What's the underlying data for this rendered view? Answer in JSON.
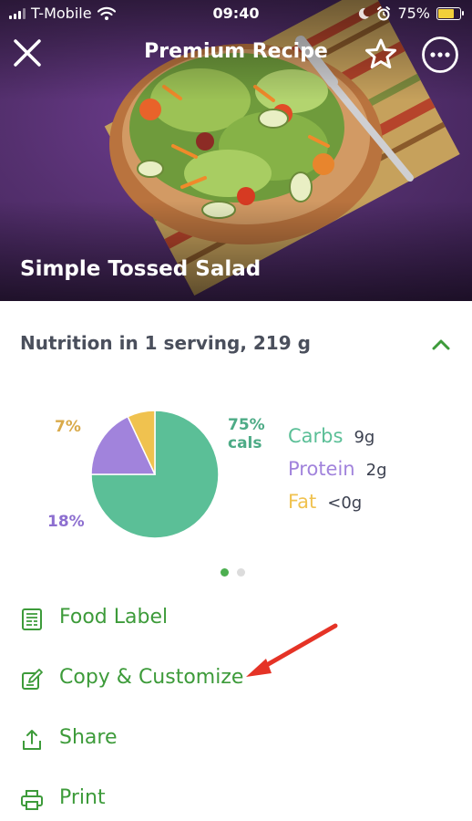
{
  "status_bar": {
    "carrier": "T-Mobile",
    "time": "09:40",
    "battery_percent": "75%",
    "battery_level": 0.75
  },
  "nav": {
    "title": "Premium Recipe",
    "close_icon": "close-icon",
    "favorite_icon": "star-outline-icon",
    "more_icon": "more-horizontal-icon"
  },
  "recipe": {
    "title": "Simple Tossed Salad"
  },
  "nutrition": {
    "header": "Nutrition in 1 serving, 219 g",
    "toggle_icon": "chevron-up-icon",
    "pct_fat": "7%",
    "pct_protein": "18%",
    "pct_carbs_value": "75%",
    "pct_carbs_unit": "cals",
    "legend": [
      {
        "name": "Carbs",
        "value": "9g",
        "color": "#5bbf97"
      },
      {
        "name": "Protein",
        "value": "2g",
        "color": "#a183dc"
      },
      {
        "name": "Fat",
        "value": "<0g",
        "color": "#f0c24f"
      }
    ],
    "pages": 2,
    "active_page": 1
  },
  "chart_data": {
    "type": "pie",
    "categories": [
      "Carbs",
      "Protein",
      "Fat"
    ],
    "values": [
      75,
      18,
      7
    ],
    "colors": [
      "#5bbf97",
      "#a183dc",
      "#f0c24f"
    ]
  },
  "actions": [
    {
      "label": "Food Label",
      "icon": "food-label-icon"
    },
    {
      "label": "Copy & Customize",
      "icon": "edit-copy-icon"
    },
    {
      "label": "Share",
      "icon": "share-icon"
    },
    {
      "label": "Print",
      "icon": "print-icon"
    }
  ],
  "colors": {
    "brand_green": "#3d9b3a",
    "hero_purple": "#55306f",
    "annotation_arrow": "#e53326"
  }
}
